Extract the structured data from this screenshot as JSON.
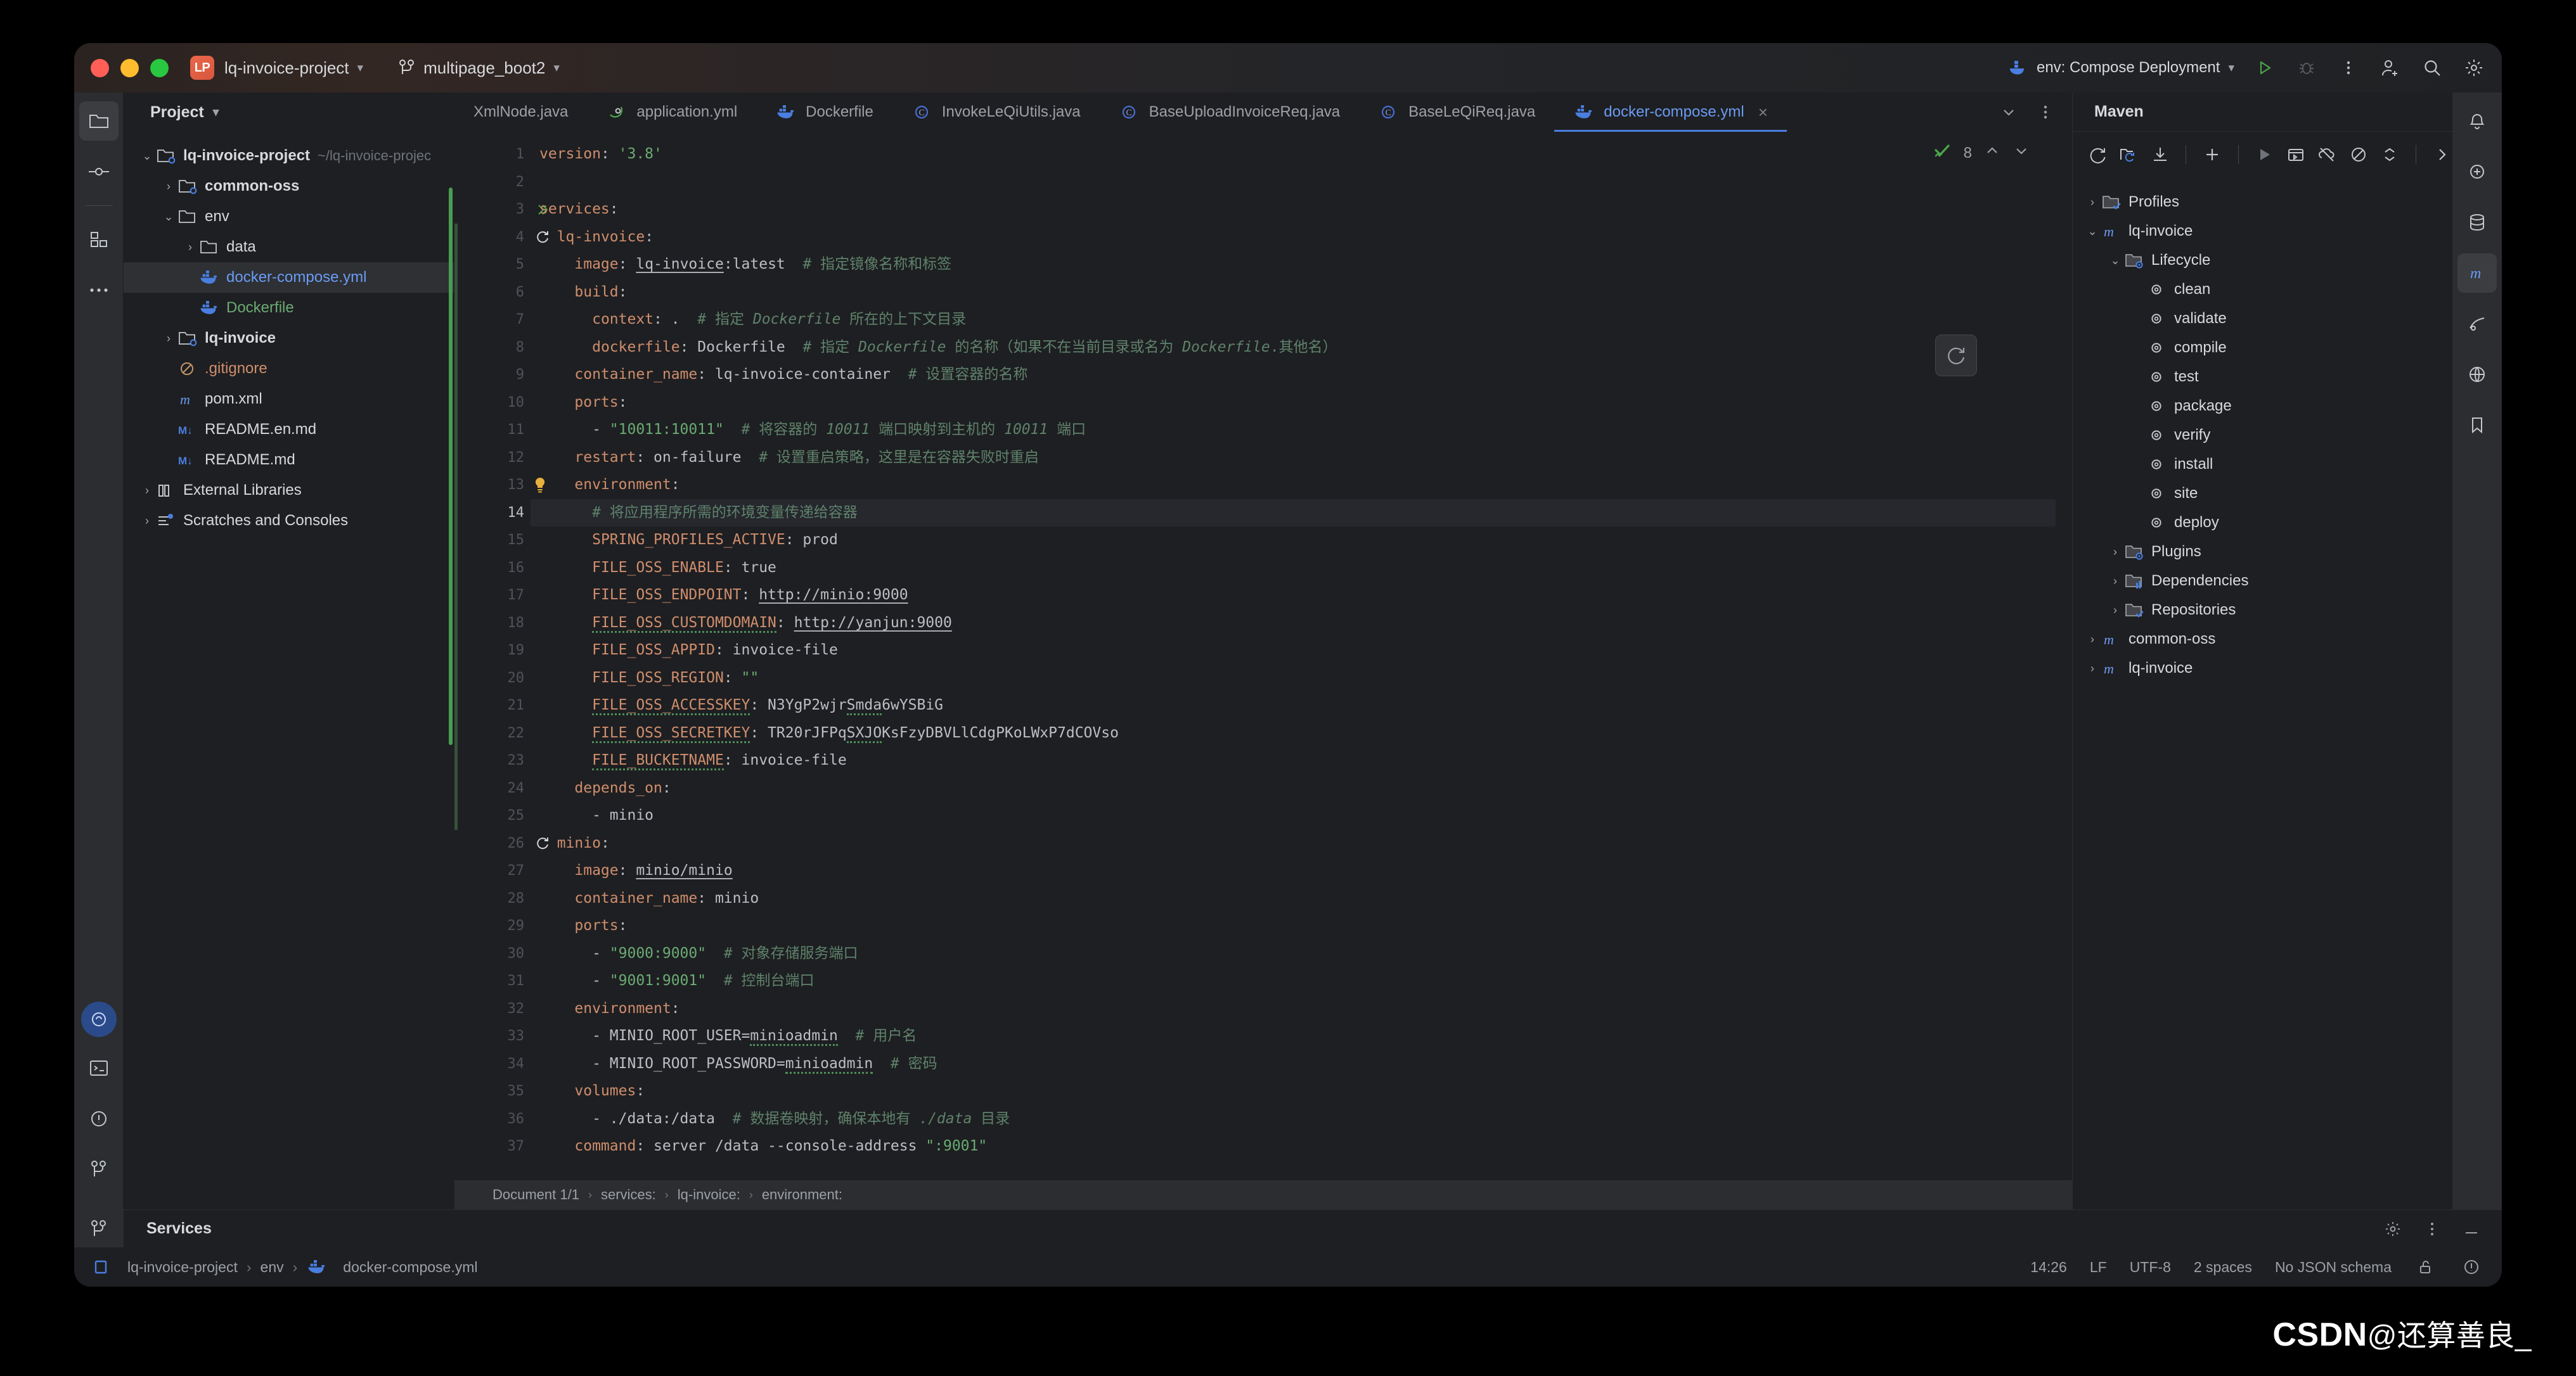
{
  "titlebar": {
    "project_badge": "LP",
    "project_name": "lq-invoice-project",
    "branch": "multipage_boot2",
    "run_config": "env: Compose Deployment"
  },
  "rail": {
    "items": [
      "project-icon",
      "commit-icon",
      "structure-icon",
      "more-icon"
    ],
    "bottom": [
      "ai-assistant-icon",
      "terminal-icon",
      "problems-icon",
      "version-control-icon"
    ]
  },
  "project": {
    "title": "Project",
    "tree": [
      {
        "label": "lq-invoice-project",
        "hint": "~/lq-invoice-projec",
        "icon": "module-folder-icon",
        "arrow": "down",
        "indent": 0,
        "bold": true,
        "color": ""
      },
      {
        "label": "common-oss",
        "hint": "",
        "icon": "module-folder-icon",
        "arrow": "right",
        "indent": 1,
        "bold": true,
        "color": ""
      },
      {
        "label": "env",
        "hint": "",
        "icon": "folder-icon",
        "arrow": "down",
        "indent": 1,
        "bold": false,
        "color": ""
      },
      {
        "label": "data",
        "hint": "",
        "icon": "folder-icon",
        "arrow": "right",
        "indent": 2,
        "bold": false,
        "color": ""
      },
      {
        "label": "docker-compose.yml",
        "hint": "",
        "icon": "docker-icon",
        "arrow": "none",
        "indent": 2,
        "bold": false,
        "color": "blue"
      },
      {
        "label": "Dockerfile",
        "hint": "",
        "icon": "docker-icon",
        "arrow": "none",
        "indent": 2,
        "bold": false,
        "color": "green"
      },
      {
        "label": "lq-invoice",
        "hint": "",
        "icon": "module-folder-icon",
        "arrow": "right",
        "indent": 1,
        "bold": true,
        "color": ""
      },
      {
        "label": ".gitignore",
        "hint": "",
        "icon": "gitignore-icon",
        "arrow": "none",
        "indent": 1,
        "bold": false,
        "color": "orange"
      },
      {
        "label": "pom.xml",
        "hint": "",
        "icon": "maven-icon",
        "arrow": "none",
        "indent": 1,
        "bold": false,
        "color": ""
      },
      {
        "label": "README.en.md",
        "hint": "",
        "icon": "markdown-icon",
        "arrow": "none",
        "indent": 1,
        "bold": false,
        "color": ""
      },
      {
        "label": "README.md",
        "hint": "",
        "icon": "markdown-icon",
        "arrow": "none",
        "indent": 1,
        "bold": false,
        "color": ""
      },
      {
        "label": "External Libraries",
        "hint": "",
        "icon": "library-icon",
        "arrow": "right",
        "indent": 0,
        "bold": false,
        "color": ""
      },
      {
        "label": "Scratches and Consoles",
        "hint": "",
        "icon": "scratches-icon",
        "arrow": "right",
        "indent": 0,
        "bold": false,
        "color": ""
      }
    ],
    "selected_index": 4
  },
  "tabs": [
    {
      "label": "XmlNode.java",
      "icon": "java-class-icon",
      "active": false,
      "clipped": true
    },
    {
      "label": "application.yml",
      "icon": "spring-icon",
      "active": false,
      "clipped": false
    },
    {
      "label": "Dockerfile",
      "icon": "docker-icon",
      "active": false,
      "clipped": false
    },
    {
      "label": "InvokeLeQiUtils.java",
      "icon": "java-class-icon",
      "active": false,
      "clipped": false
    },
    {
      "label": "BaseUploadInvoiceReq.java",
      "icon": "java-class-icon",
      "active": false,
      "clipped": false
    },
    {
      "label": "BaseLeQiReq.java",
      "icon": "java-class-icon",
      "active": false,
      "clipped": false
    },
    {
      "label": "docker-compose.yml",
      "icon": "docker-icon",
      "active": true,
      "clipped": false
    }
  ],
  "editor": {
    "inspection_count": "8",
    "current_line": 14,
    "lines": [
      {
        "n": 1,
        "segs": [
          [
            "k",
            "version"
          ],
          [
            "v",
            ": "
          ],
          [
            "s",
            "'3.8'"
          ]
        ]
      },
      {
        "n": 2,
        "segs": []
      },
      {
        "n": 3,
        "segs": [
          [
            "k",
            "services"
          ],
          [
            "v",
            ":"
          ]
        ],
        "mark": "run"
      },
      {
        "n": 4,
        "segs": [
          [
            "v",
            "  "
          ],
          [
            "k",
            "lq-invoice"
          ],
          [
            "v",
            ":"
          ]
        ],
        "mark": "restart"
      },
      {
        "n": 5,
        "segs": [
          [
            "v",
            "    "
          ],
          [
            "k",
            "image"
          ],
          [
            "v",
            ": "
          ],
          [
            "u",
            "lq-invoice"
          ],
          [
            "v",
            ":latest"
          ],
          [
            "v",
            "  "
          ],
          [
            "c",
            "# "
          ],
          [
            "cn",
            "指定镜像名称和标签"
          ]
        ]
      },
      {
        "n": 6,
        "segs": [
          [
            "v",
            "    "
          ],
          [
            "k",
            "build"
          ],
          [
            "v",
            ":"
          ]
        ]
      },
      {
        "n": 7,
        "segs": [
          [
            "v",
            "      "
          ],
          [
            "k",
            "context"
          ],
          [
            "v",
            ": ."
          ],
          [
            "v",
            "  "
          ],
          [
            "c",
            "# "
          ],
          [
            "cn",
            "指定 "
          ],
          [
            "c",
            "Dockerfile"
          ],
          [
            "cn",
            " 所在的上下文目录"
          ]
        ]
      },
      {
        "n": 8,
        "segs": [
          [
            "v",
            "      "
          ],
          [
            "k",
            "dockerfile"
          ],
          [
            "v",
            ": Dockerfile"
          ],
          [
            "v",
            "  "
          ],
          [
            "c",
            "# "
          ],
          [
            "cn",
            "指定 "
          ],
          [
            "c",
            "Dockerfile"
          ],
          [
            "cn",
            " 的名称（如果不在当前目录或名为 "
          ],
          [
            "c",
            "Dockerfile"
          ],
          [
            "cn",
            ".其他名）"
          ]
        ]
      },
      {
        "n": 9,
        "segs": [
          [
            "v",
            "    "
          ],
          [
            "k",
            "container_name"
          ],
          [
            "v",
            ": lq-invoice-container"
          ],
          [
            "v",
            "  "
          ],
          [
            "c",
            "# "
          ],
          [
            "cn",
            "设置容器的名称"
          ]
        ]
      },
      {
        "n": 10,
        "segs": [
          [
            "v",
            "    "
          ],
          [
            "k",
            "ports"
          ],
          [
            "v",
            ":"
          ]
        ]
      },
      {
        "n": 11,
        "segs": [
          [
            "v",
            "      - "
          ],
          [
            "s",
            "\"10011:10011\""
          ],
          [
            "v",
            "  "
          ],
          [
            "c",
            "# "
          ],
          [
            "cn",
            "将容器的 "
          ],
          [
            "c",
            "10011"
          ],
          [
            "cn",
            " 端口映射到主机的 "
          ],
          [
            "c",
            "10011"
          ],
          [
            "cn",
            " 端口"
          ]
        ]
      },
      {
        "n": 12,
        "segs": [
          [
            "v",
            "    "
          ],
          [
            "k",
            "restart"
          ],
          [
            "v",
            ": on-failure"
          ],
          [
            "v",
            "  "
          ],
          [
            "c",
            "# "
          ],
          [
            "cn",
            "设置重启策略，这里是在容器失败时重启"
          ]
        ]
      },
      {
        "n": 13,
        "segs": [
          [
            "v",
            "    "
          ],
          [
            "k",
            "environment"
          ],
          [
            "v",
            ":"
          ]
        ],
        "mark": "bulb"
      },
      {
        "n": 14,
        "segs": [
          [
            "v",
            "      "
          ],
          [
            "c",
            "# "
          ],
          [
            "cn",
            "将应用程序所需的环境变量传递给容器"
          ]
        ],
        "hl": true
      },
      {
        "n": 15,
        "segs": [
          [
            "v",
            "      "
          ],
          [
            "k",
            "SPRING_PROFILES_ACTIVE"
          ],
          [
            "v",
            ": prod"
          ]
        ]
      },
      {
        "n": 16,
        "segs": [
          [
            "v",
            "      "
          ],
          [
            "k",
            "FILE_OSS_ENABLE"
          ],
          [
            "v",
            ": true"
          ]
        ]
      },
      {
        "n": 17,
        "segs": [
          [
            "v",
            "      "
          ],
          [
            "k",
            "FILE_OSS_ENDPOINT"
          ],
          [
            "v",
            ": "
          ],
          [
            "u",
            "http://minio:9000"
          ]
        ]
      },
      {
        "n": 18,
        "segs": [
          [
            "v",
            "      "
          ],
          [
            "k sq",
            "FILE_OSS_CUSTOMDOMAIN"
          ],
          [
            "v",
            ": "
          ],
          [
            "u",
            "http://yanjun:9000"
          ]
        ]
      },
      {
        "n": 19,
        "segs": [
          [
            "v",
            "      "
          ],
          [
            "k",
            "FILE_OSS_APPID"
          ],
          [
            "v",
            ": invoice-file"
          ]
        ]
      },
      {
        "n": 20,
        "segs": [
          [
            "v",
            "      "
          ],
          [
            "k",
            "FILE_OSS_REGION"
          ],
          [
            "v",
            ": "
          ],
          [
            "s",
            "\"\""
          ]
        ]
      },
      {
        "n": 21,
        "segs": [
          [
            "v",
            "      "
          ],
          [
            "k sq",
            "FILE_OSS_ACCESSKEY"
          ],
          [
            "v",
            ": N3YgP2wjr"
          ],
          [
            "v sq",
            "Smda"
          ],
          [
            "v",
            "6wYSBiG"
          ]
        ]
      },
      {
        "n": 22,
        "segs": [
          [
            "v",
            "      "
          ],
          [
            "k sq",
            "FILE_OSS_SECRETKEY"
          ],
          [
            "v",
            ": TR20rJFPq"
          ],
          [
            "v sq",
            "SXJO"
          ],
          [
            "v",
            "KsFzyDBVLlCdgPKoLWxP7dCOVso"
          ]
        ]
      },
      {
        "n": 23,
        "segs": [
          [
            "v",
            "      "
          ],
          [
            "k sq",
            "FILE_BUCKETNAME"
          ],
          [
            "v",
            ": invoice-file"
          ]
        ]
      },
      {
        "n": 24,
        "segs": [
          [
            "v",
            "    "
          ],
          [
            "k",
            "depends_on"
          ],
          [
            "v",
            ":"
          ]
        ]
      },
      {
        "n": 25,
        "segs": [
          [
            "v",
            "      - minio"
          ]
        ]
      },
      {
        "n": 26,
        "segs": [
          [
            "v",
            "  "
          ],
          [
            "k",
            "minio"
          ],
          [
            "v",
            ":"
          ]
        ],
        "mark": "restart"
      },
      {
        "n": 27,
        "segs": [
          [
            "v",
            "    "
          ],
          [
            "k",
            "image"
          ],
          [
            "v",
            ": "
          ],
          [
            "u",
            "minio/minio"
          ]
        ]
      },
      {
        "n": 28,
        "segs": [
          [
            "v",
            "    "
          ],
          [
            "k",
            "container_name"
          ],
          [
            "v",
            ": minio"
          ]
        ]
      },
      {
        "n": 29,
        "segs": [
          [
            "v",
            "    "
          ],
          [
            "k",
            "ports"
          ],
          [
            "v",
            ":"
          ]
        ]
      },
      {
        "n": 30,
        "segs": [
          [
            "v",
            "      - "
          ],
          [
            "s",
            "\"9000:9000\""
          ],
          [
            "v",
            "  "
          ],
          [
            "c",
            "# "
          ],
          [
            "cn",
            "对象存储服务端口"
          ]
        ]
      },
      {
        "n": 31,
        "segs": [
          [
            "v",
            "      - "
          ],
          [
            "s",
            "\"9001:9001\""
          ],
          [
            "v",
            "  "
          ],
          [
            "c",
            "# "
          ],
          [
            "cn",
            "控制台端口"
          ]
        ]
      },
      {
        "n": 32,
        "segs": [
          [
            "v",
            "    "
          ],
          [
            "k",
            "environment"
          ],
          [
            "v",
            ":"
          ]
        ]
      },
      {
        "n": 33,
        "segs": [
          [
            "v",
            "      - MINIO_ROOT_USER="
          ],
          [
            "v sq",
            "minioadmin"
          ],
          [
            "v",
            "  "
          ],
          [
            "c",
            "# "
          ],
          [
            "cn",
            "用户名"
          ]
        ]
      },
      {
        "n": 34,
        "segs": [
          [
            "v",
            "      - MINIO_ROOT_PASSWORD="
          ],
          [
            "v sq",
            "minioadmin"
          ],
          [
            "v",
            "  "
          ],
          [
            "c",
            "# "
          ],
          [
            "cn",
            "密码"
          ]
        ]
      },
      {
        "n": 35,
        "segs": [
          [
            "v",
            "    "
          ],
          [
            "k",
            "volumes"
          ],
          [
            "v",
            ":"
          ]
        ]
      },
      {
        "n": 36,
        "segs": [
          [
            "v",
            "      - ./data:/data"
          ],
          [
            "v",
            "  "
          ],
          [
            "c",
            "# "
          ],
          [
            "cn",
            "数据卷映射，确保本地有 "
          ],
          [
            "c",
            "./data"
          ],
          [
            "cn",
            " 目录"
          ]
        ]
      },
      {
        "n": 37,
        "segs": [
          [
            "v",
            "    "
          ],
          [
            "k",
            "command"
          ],
          [
            "v",
            ": server /data --console-address "
          ],
          [
            "s",
            "\":9001\""
          ]
        ]
      }
    ]
  },
  "breadcrumb": {
    "items": [
      "Document 1/1",
      "services:",
      "lq-invoice:",
      "environment:"
    ]
  },
  "maven": {
    "title": "Maven",
    "toolbar": [
      "reload-icon",
      "reload-project-icon",
      "download-sources-icon",
      "add-icon",
      "run-icon",
      "execute-goal-icon",
      "offline-mode-icon",
      "skip-tests-icon",
      "collapse-all-icon",
      "more-icon"
    ],
    "tree": [
      {
        "label": "Profiles",
        "icon": "folder-check-icon",
        "arrow": "right",
        "indent": 0
      },
      {
        "label": "lq-invoice",
        "icon": "maven-icon",
        "arrow": "down",
        "indent": 0
      },
      {
        "label": "Lifecycle",
        "icon": "folder-gear-icon",
        "arrow": "down",
        "indent": 1
      },
      {
        "label": "clean",
        "icon": "gear-icon",
        "arrow": "none",
        "indent": 2
      },
      {
        "label": "validate",
        "icon": "gear-icon",
        "arrow": "none",
        "indent": 2
      },
      {
        "label": "compile",
        "icon": "gear-icon",
        "arrow": "none",
        "indent": 2
      },
      {
        "label": "test",
        "icon": "gear-icon",
        "arrow": "none",
        "indent": 2
      },
      {
        "label": "package",
        "icon": "gear-icon",
        "arrow": "none",
        "indent": 2
      },
      {
        "label": "verify",
        "icon": "gear-icon",
        "arrow": "none",
        "indent": 2
      },
      {
        "label": "install",
        "icon": "gear-icon",
        "arrow": "none",
        "indent": 2
      },
      {
        "label": "site",
        "icon": "gear-icon",
        "arrow": "none",
        "indent": 2
      },
      {
        "label": "deploy",
        "icon": "gear-icon",
        "arrow": "none",
        "indent": 2
      },
      {
        "label": "Plugins",
        "icon": "folder-gear-icon",
        "arrow": "right",
        "indent": 1
      },
      {
        "label": "Dependencies",
        "icon": "folder-deps-icon",
        "arrow": "right",
        "indent": 1
      },
      {
        "label": "Repositories",
        "icon": "folder-check-icon",
        "arrow": "right",
        "indent": 1
      },
      {
        "label": "common-oss",
        "icon": "maven-icon",
        "arrow": "right",
        "indent": 0
      },
      {
        "label": "lq-invoice",
        "icon": "maven-icon",
        "arrow": "right",
        "indent": 0
      }
    ]
  },
  "services": {
    "title": "Services"
  },
  "statusbar": {
    "path": [
      "lq-invoice-project",
      "env",
      "docker-compose.yml"
    ],
    "caret": "14:26",
    "line_separator": "LF",
    "encoding": "UTF-8",
    "indent": "2 spaces",
    "schema": "No JSON schema"
  },
  "watermark": {
    "brand": "CSDN",
    "author": "@还算善良_"
  },
  "colors": {
    "accent_blue": "#6a9bf4",
    "green": "#6aab73",
    "orange_key": "#cf8e6d",
    "comment": "#5f826b",
    "bg": "#1e1f22",
    "panel": "#2b2d30"
  }
}
